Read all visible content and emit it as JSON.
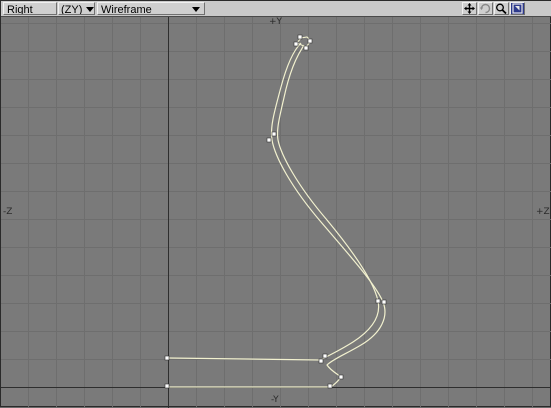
{
  "toolbar": {
    "view_label": "Right",
    "axes_label": "(ZY)",
    "render_mode_label": "Wireframe",
    "icons": [
      "move-icon",
      "rotate-icon",
      "zoom-icon",
      "maximize-icon"
    ]
  },
  "viewport": {
    "axis_labels": {
      "top": "+Y",
      "bottom": "-Y",
      "left": "-Z",
      "right": "+Z"
    }
  },
  "colors": {
    "background": "#7a7a7a",
    "grid_minor": "#6e6e6e",
    "grid_major": "#2e2e2e",
    "curve": "#f2f1cf",
    "point": "#ffffff"
  }
}
